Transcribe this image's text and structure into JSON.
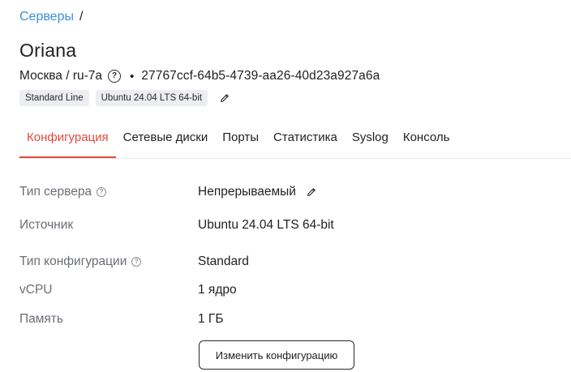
{
  "breadcrumb": {
    "servers_link": "Серверы",
    "separator": "/"
  },
  "server": {
    "name": "Oriana",
    "location": "Москва / ru-7a",
    "bullet": "•",
    "id": "27767ccf-64b5-4739-aa26-40d23a927a6a",
    "tags": [
      "Standard Line",
      "Ubuntu 24.04 LTS 64-bit"
    ]
  },
  "icons": {
    "help": "?"
  },
  "tabs": [
    {
      "label": "Конфигурация",
      "active": true
    },
    {
      "label": "Сетевые диски",
      "active": false
    },
    {
      "label": "Порты",
      "active": false
    },
    {
      "label": "Статистика",
      "active": false
    },
    {
      "label": "Syslog",
      "active": false
    },
    {
      "label": "Консоль",
      "active": false
    }
  ],
  "config": {
    "server_type": {
      "label": "Тип сервера",
      "value": "Непрерываемый"
    },
    "source": {
      "label": "Источник",
      "value": "Ubuntu 24.04 LTS 64-bit"
    },
    "config_type": {
      "label": "Тип конфигурации",
      "value": "Standard"
    },
    "vcpu": {
      "label": "vCPU",
      "value": "1 ядро"
    },
    "memory": {
      "label": "Память",
      "value": "1 ГБ"
    }
  },
  "actions": {
    "change_config": "Изменить конфигурацию"
  },
  "colors": {
    "link": "#3b8ee0",
    "accent": "#e2483d",
    "tag_bg": "#eceef1",
    "label": "#6b6e76",
    "text": "#1f1f24"
  }
}
